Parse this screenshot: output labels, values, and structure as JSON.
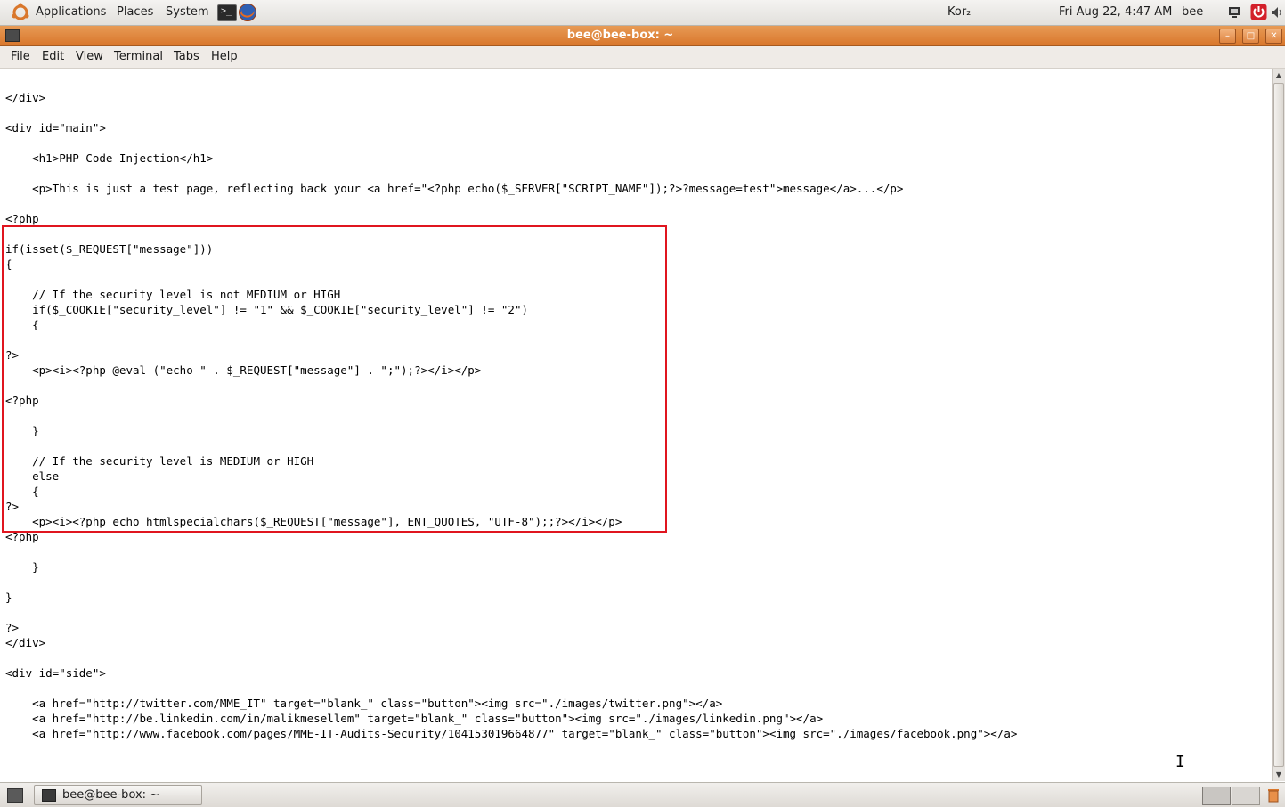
{
  "top_panel": {
    "menus": [
      "Applications",
      "Places",
      "System"
    ],
    "keyboard_layout": "Kor₂",
    "datetime": "Fri Aug 22,  4:47 AM",
    "user": "bee"
  },
  "window": {
    "title": "bee@bee-box: ~",
    "buttons": [
      "minimize",
      "maximize",
      "close"
    ]
  },
  "menubar": [
    "File",
    "Edit",
    "View",
    "Terminal",
    "Tabs",
    "Help"
  ],
  "terminal": {
    "lines": [
      "</div>",
      "",
      "<div id=\"main\">",
      "",
      "    <h1>PHP Code Injection</h1>",
      "",
      "    <p>This is just a test page, reflecting back your <a href=\"<?php echo($_SERVER[\"SCRIPT_NAME\"]);?>?message=test\">message</a>...</p>",
      "",
      "<?php",
      "",
      "if(isset($_REQUEST[\"message\"]))",
      "{",
      "",
      "    // If the security level is not MEDIUM or HIGH",
      "    if($_COOKIE[\"security_level\"] != \"1\" && $_COOKIE[\"security_level\"] != \"2\")",
      "    {",
      "",
      "?>",
      "    <p><i><?php @eval (\"echo \" . $_REQUEST[\"message\"] . \";\");?></i></p>",
      "",
      "<?php",
      "",
      "    }",
      "",
      "    // If the security level is MEDIUM or HIGH",
      "    else",
      "    {",
      "?>",
      "    <p><i><?php echo htmlspecialchars($_REQUEST[\"message\"], ENT_QUOTES, \"UTF-8\");;?></i></p>",
      "<?php",
      "",
      "    }",
      "",
      "}",
      "",
      "?>",
      "</div>",
      "",
      "<div id=\"side\">",
      "",
      "    <a href=\"http://twitter.com/MME_IT\" target=\"blank_\" class=\"button\"><img src=\"./images/twitter.png\"></a>",
      "    <a href=\"http://be.linkedin.com/in/malikmesellem\" target=\"blank_\" class=\"button\"><img src=\"./images/linkedin.png\"></a>",
      "    <a href=\"http://www.facebook.com/pages/MME-IT-Audits-Security/104153019664877\" target=\"blank_\" class=\"button\"><img src=\"./images/facebook.png\"></a>"
    ]
  },
  "taskbar": {
    "task_label": "bee@bee-box: ~"
  },
  "colors": {
    "titlebar": "#d9772c",
    "highlight_box": "#e0151f",
    "panel": "#efebe7"
  },
  "icons": [
    "ubuntu-logo-icon",
    "terminal-launcher-icon",
    "firefox-icon",
    "network-icon",
    "power-icon",
    "volume-icon",
    "show-desktop-icon",
    "trash-icon"
  ]
}
